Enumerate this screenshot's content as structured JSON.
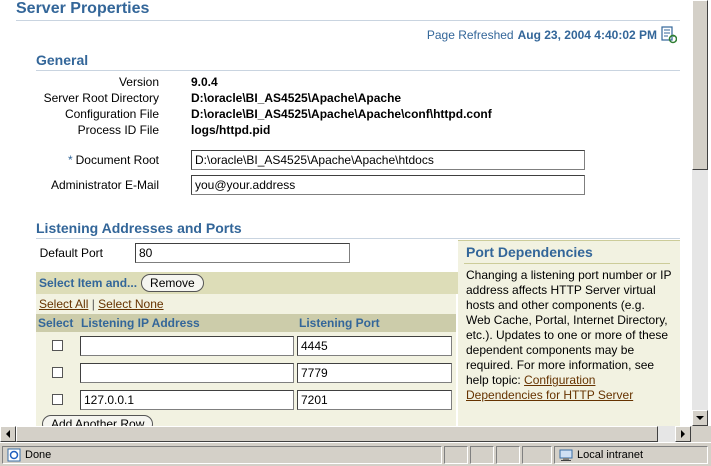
{
  "page": {
    "title": "Server Properties",
    "refreshed_label": "Page Refreshed",
    "refreshed_time": "Aug 23, 2004 4:40:02 PM"
  },
  "general": {
    "header": "General",
    "version_label": "Version",
    "version_value": "9.0.4",
    "root_label": "Server Root Directory",
    "root_value": "D:\\oracle\\BI_AS4525\\Apache\\Apache",
    "config_label": "Configuration File",
    "config_value": "D:\\oracle\\BI_AS4525\\Apache\\Apache\\conf\\httpd.conf",
    "pid_label": "Process ID File",
    "pid_value": "logs/httpd.pid",
    "required_marker": "*",
    "docroot_label": "Document Root",
    "docroot_value": "D:\\oracle\\BI_AS4525\\Apache\\Apache\\htdocs",
    "admin_label": "Administrator E-Mail",
    "admin_value": "you@your.address"
  },
  "listening": {
    "header": "Listening Addresses and Ports",
    "default_port_label": "Default Port",
    "default_port_value": "80",
    "select_item_label": "Select Item and...",
    "remove_label": "Remove",
    "select_all": "Select All",
    "separator": "|",
    "select_none": "Select None",
    "columns": [
      "Select",
      "Listening IP Address",
      "Listening Port"
    ],
    "rows": [
      {
        "ip": "",
        "port": "4445"
      },
      {
        "ip": "",
        "port": "7779"
      },
      {
        "ip": "127.0.0.1",
        "port": "7201"
      }
    ],
    "add_row_label": "Add Another Row"
  },
  "dependencies": {
    "header": "Port Dependencies",
    "text": "Changing a listening port number or IP address affects HTTP Server virtual hosts and other components (e.g. Web Cache, Portal, Internet Directory, etc.). Updates to one or more of these dependent components may be required. For more information, see help topic:",
    "link": "Configuration Dependencies for HTTP Server"
  },
  "statusbar": {
    "status": "Done",
    "zone": "Local intranet"
  },
  "colors": {
    "header_blue": "#336699",
    "link_brown": "#663300",
    "table_bg": "#f2f2e1",
    "header_row": "#ccccaa"
  }
}
